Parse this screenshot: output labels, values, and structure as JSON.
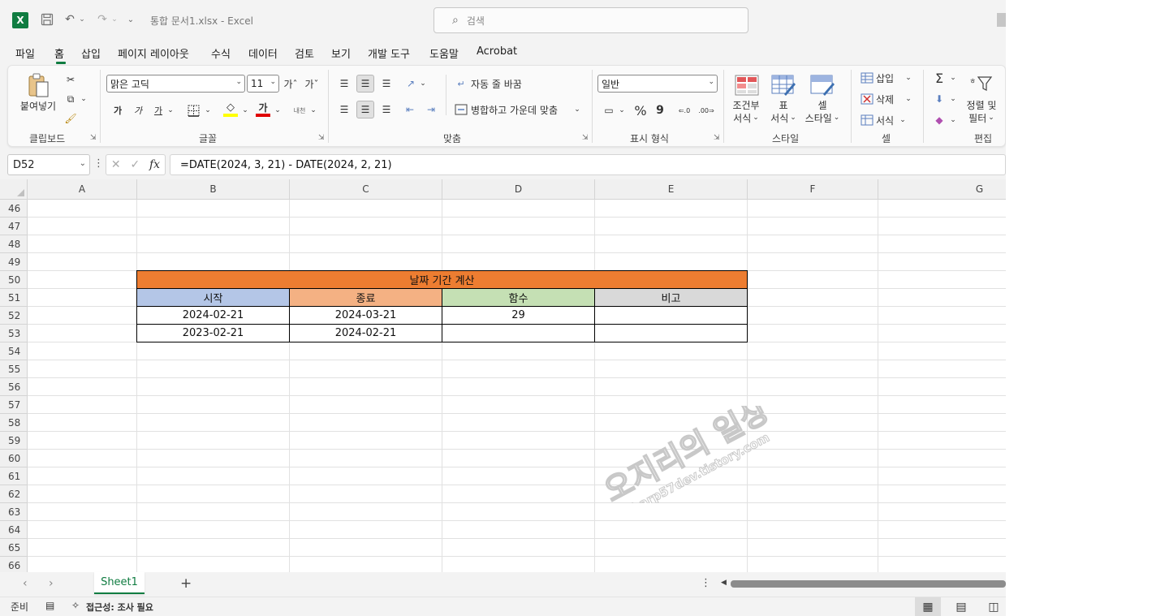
{
  "titlebar": {
    "logo": "X",
    "doc_title": "통합 문서1.xlsx  -  Excel",
    "search_placeholder": "검색"
  },
  "tabs": [
    "파일",
    "홈",
    "삽입",
    "페이지 레이아웃",
    "수식",
    "데이터",
    "검토",
    "보기",
    "개발 도구",
    "도움말",
    "Acrobat"
  ],
  "active_tab": "홈",
  "ribbon": {
    "clipboard": {
      "paste": "붙여넣기",
      "label": "클립보드"
    },
    "font": {
      "font_name": "맑은 고딕",
      "font_size": "11",
      "grow": "가ˆ",
      "shrink": "가ˇ",
      "bold": "가",
      "italic": "가",
      "underline": "가",
      "font_color": "가",
      "phonetic": "내천",
      "label": "글꼴"
    },
    "alignment": {
      "wrap": "자동 줄 바꿈",
      "merge": "병합하고 가운데 맞춤",
      "label": "맞춤"
    },
    "number": {
      "format": "일반",
      "percent": "%",
      "comma": "9",
      "label": "표시 형식"
    },
    "styles": {
      "conditional_1": "조건부",
      "conditional_2": "서식",
      "table_1": "표",
      "table_2": "서식",
      "cell_1": "셀",
      "cell_2": "스타일",
      "label": "스타일"
    },
    "cells": {
      "insert": "삽입",
      "delete": "삭제",
      "format": "서식",
      "label": "셀"
    },
    "editing": {
      "sort_1": "정렬 및",
      "sort_2": "필터",
      "label": "편집"
    }
  },
  "formula_bar": {
    "name_box": "D52",
    "formula": "=DATE(2024, 3, 21) - DATE(2024, 2, 21)",
    "fx": "fx"
  },
  "columns": [
    "A",
    "B",
    "C",
    "D",
    "E",
    "F",
    "G"
  ],
  "rows": [
    "46",
    "47",
    "48",
    "49",
    "50",
    "51",
    "52",
    "53",
    "54",
    "55",
    "56",
    "57",
    "58",
    "59",
    "60",
    "61",
    "62",
    "63",
    "64",
    "65",
    "66"
  ],
  "table": {
    "title": "날짜 기간 계산",
    "headers": [
      "시작",
      "종료",
      "함수",
      "비고"
    ],
    "rows": [
      [
        "2024-02-21",
        "2024-03-21",
        "29",
        ""
      ],
      [
        "2023-02-21",
        "2024-02-21",
        "",
        ""
      ]
    ]
  },
  "watermark": {
    "main": "오지리의 일상",
    "url": "sharp57dev.tistory.com"
  },
  "sheets": [
    "Sheet1"
  ],
  "statusbar": {
    "ready": "준비",
    "accessibility": "접근성: 조사 필요"
  },
  "colors": {
    "excel_green": "#107c41",
    "title_fill": "#ed7d31",
    "header_start": "#b4c6e7",
    "header_end": "#f4b183",
    "header_function": "#c5e0b4",
    "header_note": "#d9d9d9"
  }
}
